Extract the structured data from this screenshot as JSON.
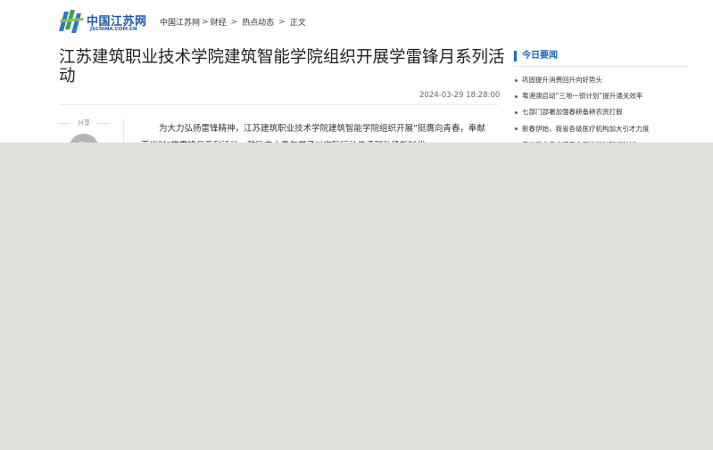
{
  "site": {
    "logo_cn": "中国江苏网",
    "logo_en": "JSCHINA.COM.CN"
  },
  "breadcrumb": [
    {
      "label": "中国江苏网"
    },
    {
      "label": "财经"
    },
    {
      "label": "热点动态"
    },
    {
      "label": "正文"
    }
  ],
  "breadcrumb_sep": ">",
  "article": {
    "title": "江苏建筑职业技术学院建筑智能学院组织开展学雷锋月系列活动",
    "datetime": "2024-03-29 18:28:00",
    "body": "为大力弘扬雷锋精神，江苏建筑职业技术学院建筑智能学院组织开展“挺膺向青春，奉献正当时”学雷锋月系列活动，鼓励广大青年学子以实际行动传承和弘扬新时代"
  },
  "share": {
    "label": "分享"
  },
  "sidebar": {
    "title": "今日要闻",
    "items": [
      "巩固提升消费回升向好势头",
      "粤港澳启动“三地一锁计划”提升通关效率",
      "七部门部署加强春耕备耕农资打假",
      "新春伊始，我省各级医疗机构加大引才力度",
      "泰州工业产业项目全面推行“超时默认”"
    ]
  },
  "colors": {
    "brand": "#1a5aa6",
    "accent": "#1a6bbf",
    "overlay": "#e1dfdc"
  }
}
